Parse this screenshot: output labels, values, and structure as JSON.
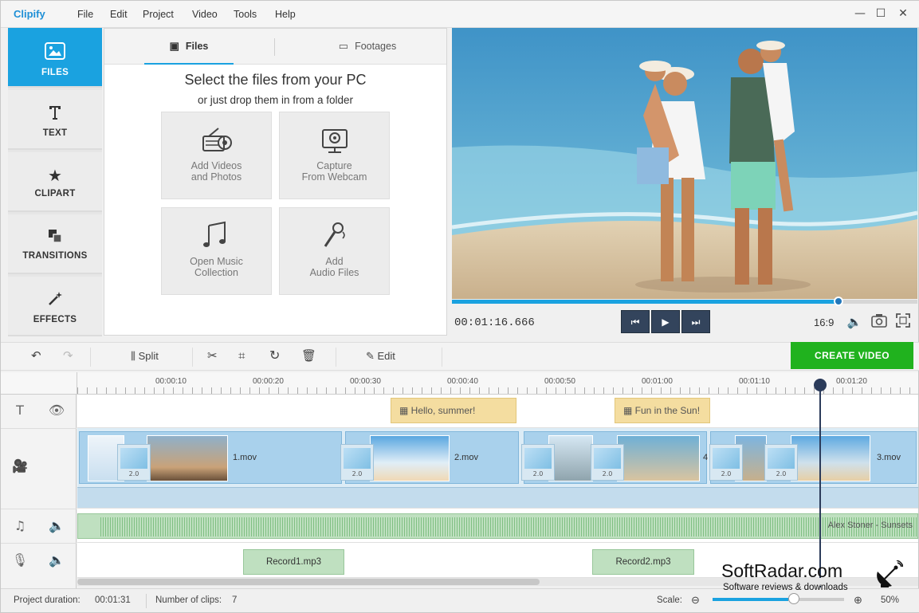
{
  "app": {
    "title": "Clipify"
  },
  "menu": [
    "File",
    "Edit",
    "Project",
    "Video",
    "Tools",
    "Help"
  ],
  "window_controls": {
    "minimize": "—",
    "maximize": "☐",
    "close": "✕"
  },
  "sidebar": {
    "items": [
      {
        "label": "FILES",
        "icon": "image-icon",
        "active": true
      },
      {
        "label": "TEXT",
        "icon": "text-icon",
        "active": false
      },
      {
        "label": "CLIPART",
        "icon": "star-icon",
        "active": false
      },
      {
        "label": "TRANSITIONS",
        "icon": "transitions-icon",
        "active": false
      },
      {
        "label": "EFFECTS",
        "icon": "magic-wand-icon",
        "active": false
      }
    ]
  },
  "files_panel": {
    "tabs": [
      "Files",
      "Footages"
    ],
    "heading": "Select the files from your PC",
    "subheading": "or just drop them in from a folder",
    "tiles": [
      {
        "line1": "Add Videos",
        "line2": "and Photos",
        "icon": "film-camera-icon"
      },
      {
        "line1": "Capture",
        "line2": "From Webcam",
        "icon": "webcam-icon"
      },
      {
        "line1": "Open Music",
        "line2": "Collection",
        "icon": "music-notes-icon"
      },
      {
        "line1": "Add",
        "line2": "Audio Files",
        "icon": "microphone-icon"
      }
    ]
  },
  "player": {
    "timecode": "00:01:16.666",
    "progress": 0.83,
    "aspect_ratio": "16:9"
  },
  "toolbar": {
    "split": "Split",
    "edit": "Edit",
    "create_video": "CREATE VIDEO"
  },
  "timeline": {
    "ruler": [
      "00:00:10",
      "00:00:20",
      "00:00:30",
      "00:00:40",
      "00:00:50",
      "00:01:00",
      "00:01:10",
      "00:01:20"
    ],
    "title_clips": [
      "Hello, summer!",
      "Fun in the Sun!"
    ],
    "video_clips": [
      "1.mov",
      "2.mov",
      "4",
      "3.mov"
    ],
    "transition_duration": "2.0",
    "music_track": "Alex Stoner - Sunsets",
    "records": [
      "Record1.mp3",
      "Record2.mp3"
    ]
  },
  "status": {
    "project_duration_label": "Project duration:",
    "project_duration": "00:01:31",
    "clips_label": "Number of clips:",
    "clips": "7",
    "scale_label": "Scale:",
    "zoom": "50%"
  },
  "watermark": {
    "title": "SoftRadar.com",
    "subtitle": "Software reviews & downloads"
  },
  "colors": {
    "accent": "#1aa2e0",
    "create": "#20b21e",
    "title_clip": "#f4dda0",
    "video_clip": "#a9d1ec",
    "audio": "#bfe0c0"
  }
}
